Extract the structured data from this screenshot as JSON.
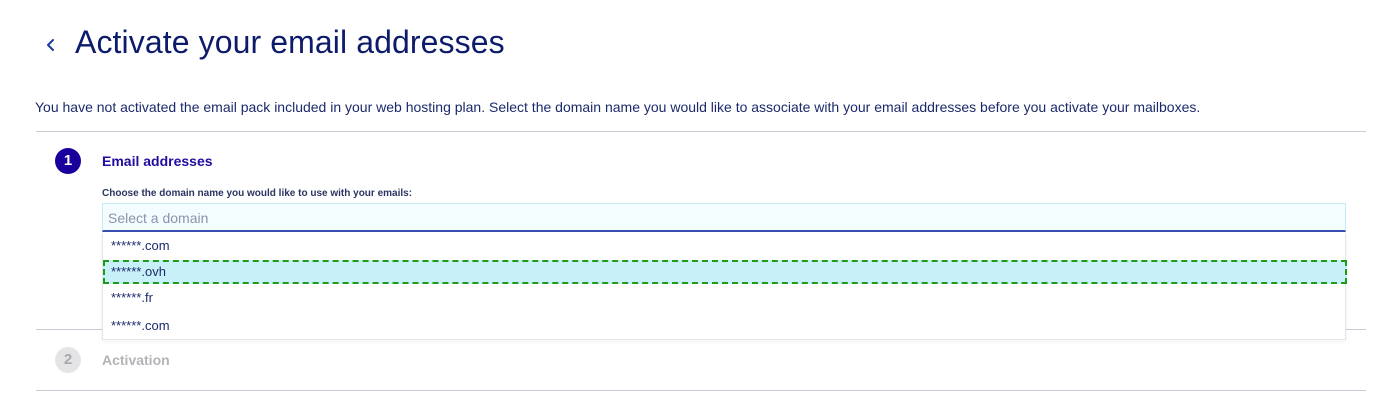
{
  "header": {
    "back_icon": "chevron-left-icon",
    "title": "Activate your email addresses"
  },
  "intro": "You have not activated the email pack included in your web hosting plan. Select the domain name you would like to associate with your email addresses before you activate your mailboxes.",
  "colors": {
    "primary": "#1f0ca0",
    "title": "#0c1b6a",
    "highlight_bg": "#c8f0f8",
    "highlight_outline": "#1e9b17"
  },
  "steps": [
    {
      "number": "1",
      "title": "Email addresses",
      "state": "active",
      "field_label": "Choose the domain name you would like to use with your emails:",
      "select": {
        "placeholder": "Select a domain",
        "options": [
          "******.com",
          "******.ovh",
          "******.fr",
          "******.com"
        ],
        "highlighted_index": 1
      }
    },
    {
      "number": "2",
      "title": "Activation",
      "state": "inactive"
    }
  ]
}
